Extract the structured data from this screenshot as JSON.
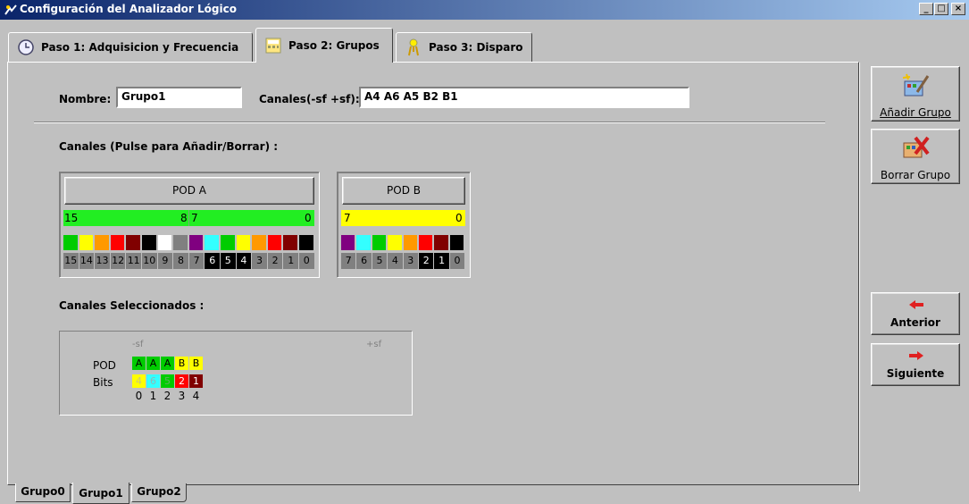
{
  "window": {
    "title": "Configuración del Analizador Lógico",
    "buttons": [
      "_",
      "□",
      "×"
    ]
  },
  "tabs": [
    {
      "label": "Paso 1: Adquisicion y Frecuencia",
      "icon": "clock-icon"
    },
    {
      "label": "Paso 2: Grupos",
      "icon": "calculator-icon",
      "active": true
    },
    {
      "label": "Paso 3: Disparo",
      "icon": "trigger-icon"
    }
  ],
  "form": {
    "name_label": "Nombre:",
    "name_value": "Grupo1",
    "channels_label": "Canales(-sf +sf):",
    "channels_value": "A4 A6 A5 B2 B1"
  },
  "channels_heading": "Canales (Pulse para Añadir/Borrar) :",
  "pod_a": {
    "label": "POD A",
    "range_left": "15",
    "range_mid_left": "8",
    "range_mid_right": "7",
    "range_right": "0",
    "bar_color": "#22ee22",
    "colors": [
      "#00cc00",
      "#ffff00",
      "#ff9900",
      "#ff0000",
      "#800000",
      "#000000",
      "#ffffff",
      "#808080",
      "#800080",
      "#33ffff",
      "#00cc00",
      "#ffff00",
      "#ff9900",
      "#ff0000",
      "#800000",
      "#000000"
    ],
    "bits": [
      "15",
      "14",
      "13",
      "12",
      "11",
      "10",
      "9",
      "8",
      "7",
      "6",
      "5",
      "4",
      "3",
      "2",
      "1",
      "0"
    ],
    "selected": [
      false,
      false,
      false,
      false,
      false,
      false,
      false,
      false,
      false,
      true,
      true,
      true,
      false,
      false,
      false,
      false
    ]
  },
  "pod_b": {
    "label": "POD B",
    "range_left": "7",
    "range_right": "0",
    "bar_color": "#ffff00",
    "colors": [
      "#800080",
      "#33ffff",
      "#00cc00",
      "#ffff00",
      "#ff9900",
      "#ff0000",
      "#800000",
      "#000000"
    ],
    "bits": [
      "7",
      "6",
      "5",
      "4",
      "3",
      "2",
      "1",
      "0"
    ],
    "selected": [
      false,
      false,
      false,
      false,
      false,
      true,
      true,
      false
    ]
  },
  "selected_heading": "Canales Seleccionados :",
  "selected": {
    "sf_minus": "-sf",
    "sf_plus": "+sf",
    "pod_label": "POD",
    "bits_label": "Bits",
    "pods": [
      "A",
      "A",
      "A",
      "B",
      "B"
    ],
    "pod_colors": [
      "#00cc00",
      "#00cc00",
      "#00cc00",
      "#ffff00",
      "#ffff00"
    ],
    "bits": [
      "4",
      "6",
      "5",
      "2",
      "1"
    ],
    "bit_colors": [
      "#ffff00",
      "#33ffff",
      "#00cc00",
      "#ff0000",
      "#800000"
    ],
    "bit_text_colors": [
      "#c8c880",
      "#8fb8b8",
      "#60b060",
      "#ffffff",
      "#ffffff"
    ],
    "indices": [
      "0",
      "1",
      "2",
      "3",
      "4"
    ]
  },
  "side": {
    "add_group": "Añadir Grupo",
    "remove_group": "Borrar Grupo",
    "prev": "Anterior",
    "next": "Siguiente"
  },
  "group_tabs": [
    "Grupo0",
    "Grupo1",
    "Grupo2"
  ]
}
